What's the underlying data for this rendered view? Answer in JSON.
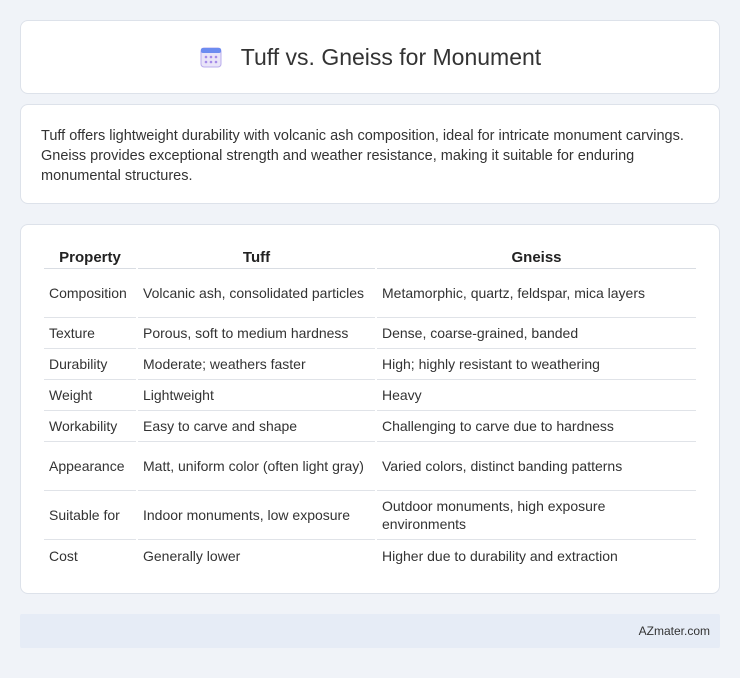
{
  "header": {
    "icon": "calendar-icon",
    "title": "Tuff vs. Gneiss for Monument"
  },
  "intro": {
    "text": "Tuff offers lightweight durability with volcanic ash composition, ideal for intricate monument carvings. Gneiss provides exceptional strength and weather resistance, making it suitable for enduring monumental structures."
  },
  "table": {
    "headers": [
      "Property",
      "Tuff",
      "Gneiss"
    ],
    "rows": [
      [
        "Composition",
        "Volcanic ash, consolidated particles",
        "Metamorphic, quartz, feldspar, mica layers"
      ],
      [
        "Texture",
        "Porous, soft to medium hardness",
        "Dense, coarse-grained, banded"
      ],
      [
        "Durability",
        "Moderate; weathers faster",
        "High; highly resistant to weathering"
      ],
      [
        "Weight",
        "Lightweight",
        "Heavy"
      ],
      [
        "Workability",
        "Easy to carve and shape",
        "Challenging to carve due to hardness"
      ],
      [
        "Appearance",
        "Matt, uniform color (often light gray)",
        "Varied colors, distinct banding patterns"
      ],
      [
        "Suitable for",
        "Indoor monuments, low exposure",
        "Outdoor monuments, high exposure environments"
      ],
      [
        "Cost",
        "Generally lower",
        "Higher due to durability and extraction"
      ]
    ]
  },
  "footer": {
    "brand": "AZmater.com"
  }
}
